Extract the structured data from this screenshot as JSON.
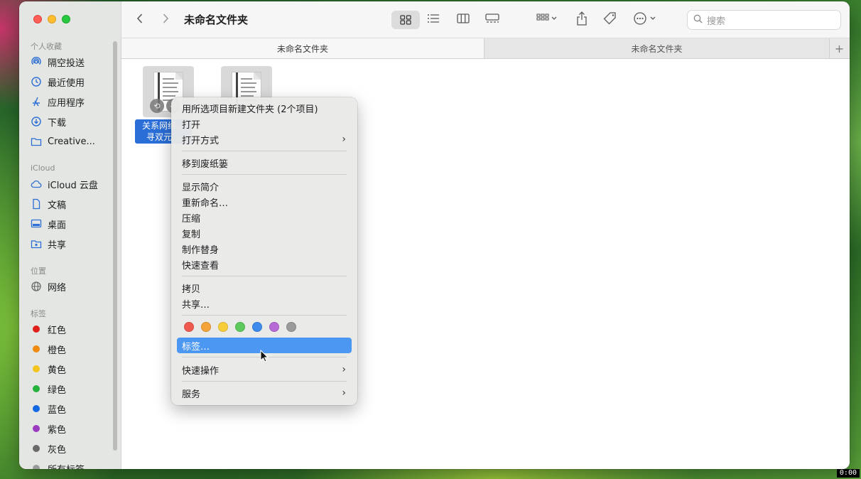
{
  "window": {
    "title": "未命名文件夹"
  },
  "sidebar": {
    "sections": [
      {
        "label": "个人收藏"
      },
      {
        "label": "iCloud"
      },
      {
        "label": "位置"
      },
      {
        "label": "标签"
      }
    ],
    "favorites": [
      {
        "label": "隔空投送",
        "icon": "airdrop-icon"
      },
      {
        "label": "最近使用",
        "icon": "clock-icon"
      },
      {
        "label": "应用程序",
        "icon": "applications-icon"
      },
      {
        "label": "下载",
        "icon": "download-icon"
      },
      {
        "label": "Creative...",
        "icon": "folder-icon"
      }
    ],
    "icloud": [
      {
        "label": "iCloud 云盘",
        "icon": "cloud-icon"
      },
      {
        "label": "文稿",
        "icon": "document-icon"
      },
      {
        "label": "桌面",
        "icon": "desktop-icon"
      },
      {
        "label": "共享",
        "icon": "shared-folder-icon"
      }
    ],
    "locations": [
      {
        "label": "网络",
        "icon": "globe-icon"
      }
    ],
    "tags": [
      {
        "label": "红色",
        "color": "#e0201b"
      },
      {
        "label": "橙色",
        "color": "#f08a0e"
      },
      {
        "label": "黄色",
        "color": "#f4c41d"
      },
      {
        "label": "绿色",
        "color": "#26b33b"
      },
      {
        "label": "蓝色",
        "color": "#1468e4"
      },
      {
        "label": "紫色",
        "color": "#9b3bc0"
      },
      {
        "label": "灰色",
        "color": "#6a6a6a"
      },
      {
        "label": "所有标签",
        "color": "#9a9a9a"
      }
    ]
  },
  "toolbar": {
    "search_placeholder": "搜索"
  },
  "tabs": [
    {
      "label": "未命名文件夹",
      "active": true
    },
    {
      "label": "未命名文件夹",
      "active": false
    }
  ],
  "tab_add_label": "+",
  "files": [
    {
      "label_line1": "关系网络、",
      "label_line2": "寻双元…"
    }
  ],
  "context_menu": {
    "items": [
      {
        "label": "用所选项目新建文件夹 (2个项目)"
      },
      {
        "label": "打开"
      },
      {
        "label": "打开方式",
        "submenu": true
      },
      {
        "label": "移到废纸篓"
      },
      {
        "label": "显示简介"
      },
      {
        "label": "重新命名…"
      },
      {
        "label": "压缩"
      },
      {
        "label": "复制"
      },
      {
        "label": "制作替身"
      },
      {
        "label": "快速查看"
      },
      {
        "label": "拷贝"
      },
      {
        "label": "共享…"
      },
      {
        "label": "标签…",
        "highlighted": true
      },
      {
        "label": "快速操作",
        "submenu": true
      },
      {
        "label": "服务",
        "submenu": true
      }
    ],
    "tag_colors": [
      "#ef5a4f",
      "#f4a23a",
      "#f7cd3a",
      "#5cc95a",
      "#3c8bec",
      "#b66ad6",
      "#9a9a9a"
    ]
  },
  "status_badge": "0:00",
  "colors": {
    "selection": "#2a6ed8",
    "menu_highlight": "#4b97f2",
    "sidebar_icon": "#2c6fd6"
  }
}
